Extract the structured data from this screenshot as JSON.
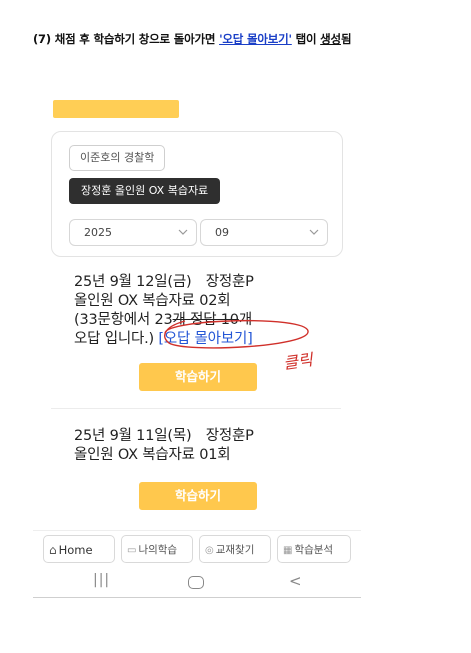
{
  "caption": {
    "prefix": "(7) 채점 후 학습하기 창으로 돌아가면 ",
    "highlight": "'오답 몰아보기'",
    "middle": " 탭이 ",
    "underlined": "생성",
    "suffix": "됨"
  },
  "filters": {
    "chip_subject": "이준호의 경찰학",
    "chip_selected": "장정훈 올인원 OX 복습자료",
    "year_value": "2025",
    "month_value": "09"
  },
  "entries": [
    {
      "line1": "25년 9월 12일(금)　장정훈P",
      "line2": "올인원 OX 복습자료 02회",
      "line3_a": "(33문항에서 23",
      "line3_b": "개 정답 10",
      "line3_c": "개",
      "line4_a": "오답 입니다.)",
      "line4_link": " [오답 몰아보기]",
      "button": "학습하기"
    },
    {
      "line1": "25년 9월 11일(목)　장정훈P",
      "line2": "올인원 OX 복습자료 01회",
      "button": "학습하기"
    }
  ],
  "annotation": {
    "text": "클릭",
    "color": "#d0302a"
  },
  "nav": {
    "home": "Home",
    "my": "나의학습",
    "book": "교재찾기",
    "analysis": "학습분석"
  },
  "icons": [
    "home-icon",
    "folder-icon",
    "search-icon",
    "chart-icon",
    "recent-apps-icon",
    "home-circle-icon",
    "back-icon",
    "chevron-down-icon"
  ],
  "colors": {
    "accent": "#ffc84d",
    "link": "#2456d6",
    "dark_chip": "#2f2f2f"
  }
}
